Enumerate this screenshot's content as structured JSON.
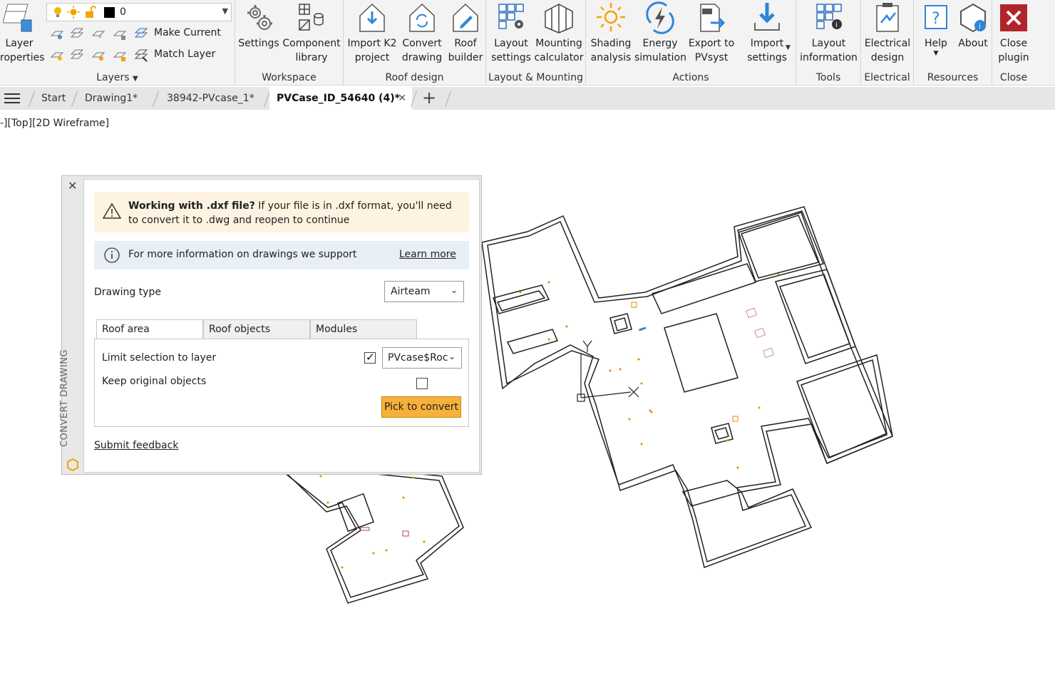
{
  "ribbon": {
    "layers": {
      "layer_properties_label": "Layer\nroperties",
      "current_layer_value": "0",
      "make_current_label": "Make Current",
      "match_layer_label": "Match Layer",
      "group_label": "Layers"
    },
    "workspace": {
      "settings_label": "Settings",
      "component_library_label": "Component\nlibrary",
      "group_label": "Workspace"
    },
    "roof_design": {
      "import_k2_label": "Import K2\nproject",
      "convert_drawing_label": "Convert\ndrawing",
      "roof_builder_label": "Roof\nbuilder",
      "group_label": "Roof design"
    },
    "layout_mounting": {
      "layout_settings_label": "Layout\nsettings",
      "mounting_calculator_label": "Mounting\ncalculator",
      "group_label": "Layout & Mounting"
    },
    "actions": {
      "shading_label": "Shading\nanalysis",
      "energy_label": "Energy\nsimulation",
      "export_label": "Export to\nPVsyst",
      "import_settings_label": "Import\nsettings",
      "group_label": "Actions"
    },
    "tools": {
      "layout_info_label": "Layout\ninformation",
      "group_label": "Tools"
    },
    "electrical": {
      "electrical_design_label": "Electrical\ndesign",
      "group_label": "Electrical"
    },
    "resources": {
      "help_label": "Help",
      "about_label": "About",
      "group_label": "Resources"
    },
    "close": {
      "close_plugin_label": "Close\nplugin",
      "group_label": "Close"
    }
  },
  "tabs": {
    "start": "Start",
    "drawing1": "Drawing1*",
    "file2": "38942-PVcase_1*",
    "active": "PVCase_ID_54640 (4)*"
  },
  "viewport_label": "-][Top][2D Wireframe]",
  "panel": {
    "side_title": "CONVERT DRAWING",
    "warning_bold": "Working with .dxf file?",
    "warning_text": " If your file is in .dxf format, you'll need to convert it to .dwg and reopen to continue",
    "info_text": "For more information on drawings we support",
    "learn_more": "Learn more",
    "drawing_type_label": "Drawing type",
    "drawing_type_value": "Airteam",
    "tabs": [
      "Roof area",
      "Roof objects",
      "Modules"
    ],
    "limit_selection_label": "Limit selection to layer",
    "limit_selection_checked": true,
    "layer_value": "PVcase$Roc",
    "keep_original_label": "Keep original objects",
    "keep_original_checked": false,
    "pick_button": "Pick to convert",
    "submit_feedback": "Submit feedback"
  },
  "colors": {
    "accent": "#f6b13a",
    "warning_bg": "#fdf3e0",
    "info_bg": "#e9eff7",
    "close_red": "#b0252a"
  }
}
